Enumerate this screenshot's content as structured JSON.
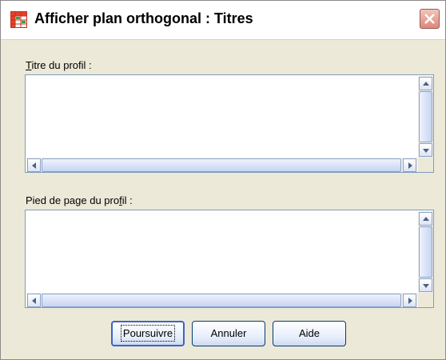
{
  "window": {
    "title": "Afficher plan orthogonal : Titres"
  },
  "profile_title": {
    "label_pre": "",
    "label_mnemonic": "T",
    "label_post": "itre du profil :",
    "value": ""
  },
  "profile_footer": {
    "label_pre": "Pied de page du pro",
    "label_mnemonic": "f",
    "label_post": "il :",
    "value": ""
  },
  "buttons": {
    "continue": "Poursuivre",
    "cancel": "Annuler",
    "help": "Aide"
  },
  "icons": {
    "app": "spreadsheet-icon",
    "close": "close-icon"
  },
  "colors": {
    "field_border": "#7f9db9",
    "button_border": "#003c74",
    "close_bg": "#e0867a"
  }
}
